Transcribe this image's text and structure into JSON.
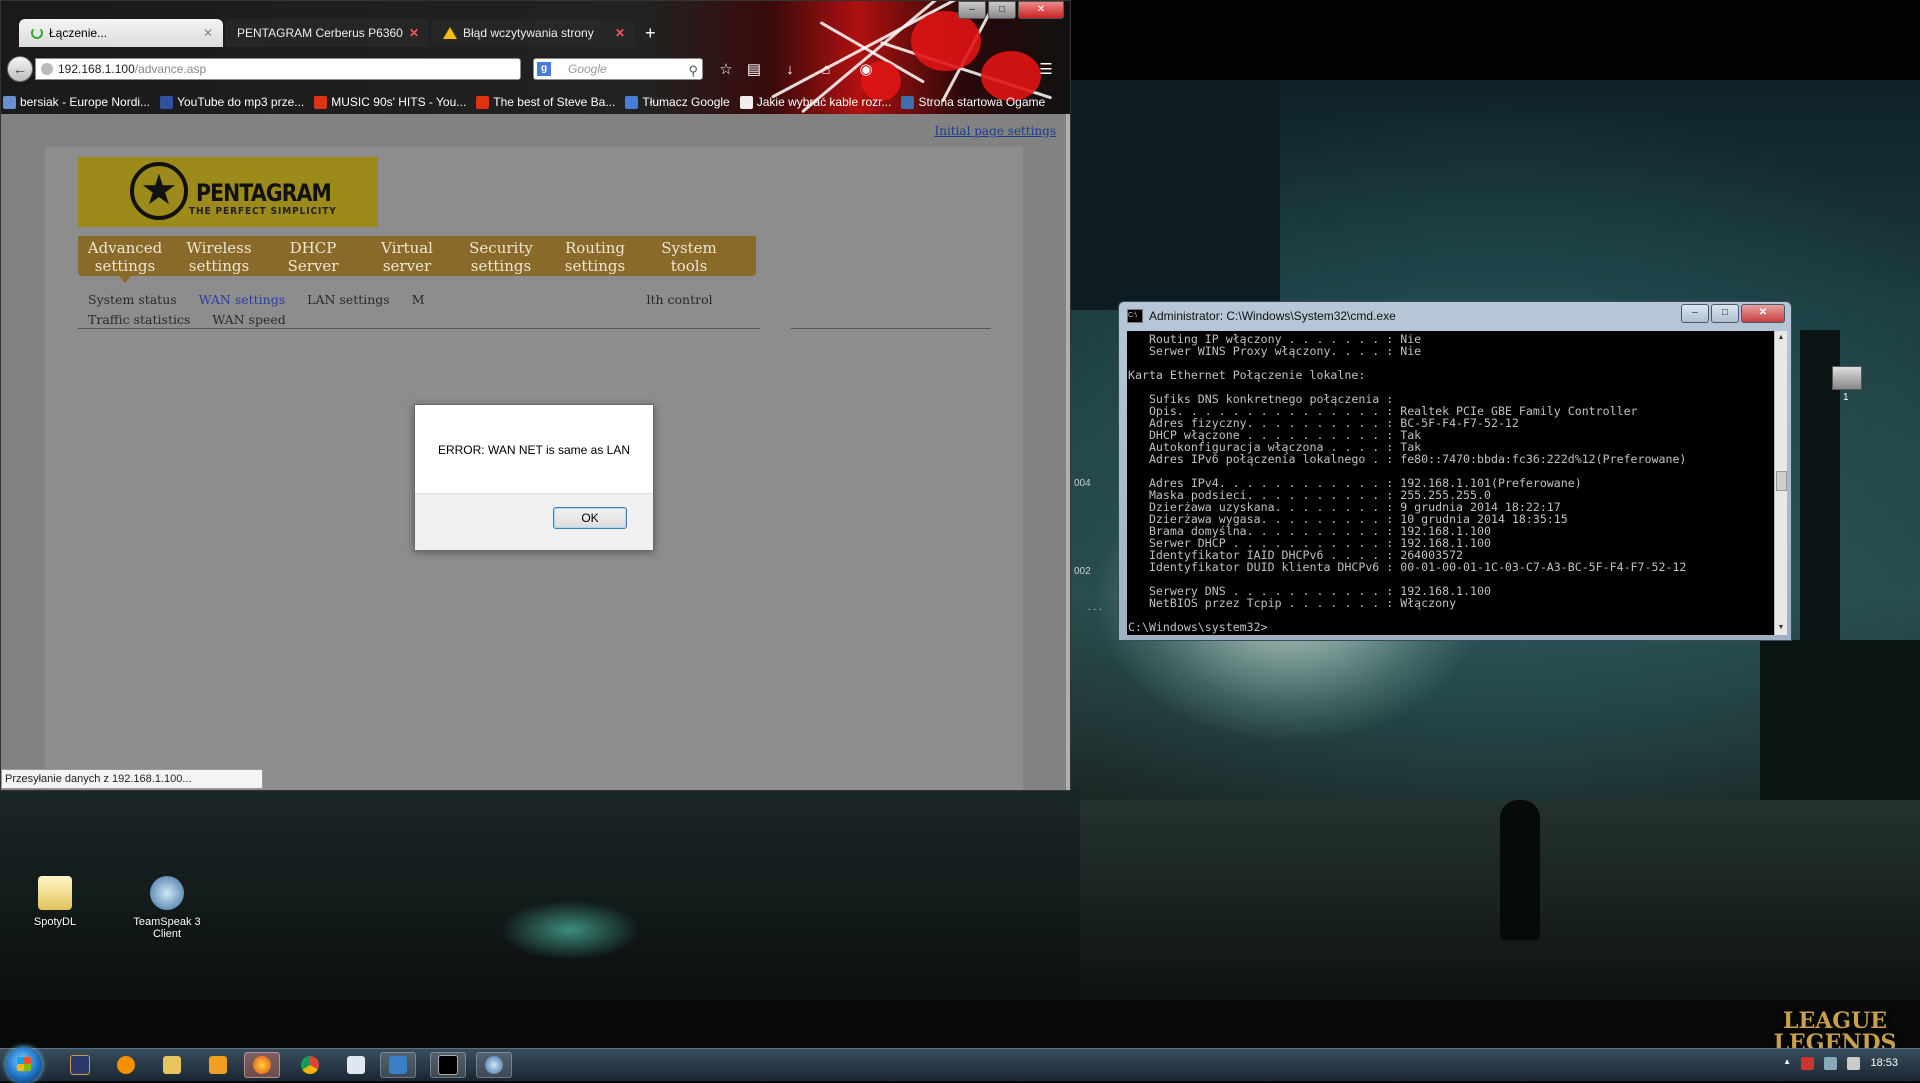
{
  "browser": {
    "tabs": [
      {
        "title": "Łączenie...",
        "active": true
      },
      {
        "title": "PENTAGRAM Cerberus P6360 P...",
        "active": false
      },
      {
        "title": "Błąd wczytywania strony",
        "active": false
      }
    ],
    "new_tab_label": "+",
    "url_host": "192.168.1.100",
    "url_path": "/advance.asp",
    "search_placeholder": "Google",
    "bookmarks": [
      "bersiak - Europe Nordi...",
      "YouTube do mp3 prze...",
      "MUSIC 90s' HITS - You...",
      "The best of Steve Ba...",
      "Tłumacz Google",
      "Jakie wybrać kable rozr...",
      "Strona startowa Ogame"
    ],
    "status_text": "Przesyłanie danych z 192.168.1.100..."
  },
  "router_page": {
    "initial_link": "Initial page settings",
    "logo_brand": "PENTAGRAM",
    "logo_tagline": "THE PERFECT SIMPLICITY",
    "menu": [
      {
        "line1": "Advanced",
        "line2": "settings"
      },
      {
        "line1": "Wireless",
        "line2": "settings"
      },
      {
        "line1": "DHCP",
        "line2": "Server"
      },
      {
        "line1": "Virtual",
        "line2": "server"
      },
      {
        "line1": "Security",
        "line2": "settings"
      },
      {
        "line1": "Routing",
        "line2": "settings"
      },
      {
        "line1": "System",
        "line2": "tools"
      }
    ],
    "submenu_row1": [
      "System status",
      "WAN settings",
      "LAN settings",
      "M",
      "lth control"
    ],
    "submenu_row2": [
      "Traffic statistics",
      "WAN speed"
    ]
  },
  "dialog": {
    "message": "ERROR: WAN NET is same as LAN",
    "ok_label": "OK"
  },
  "cmd": {
    "title": "Administrator: C:\\Windows\\System32\\cmd.exe",
    "output": "   Routing IP włączony . . . . . . . : Nie\n   Serwer WINS Proxy włączony. . . . : Nie\n\nKarta Ethernet Połączenie lokalne:\n\n   Sufiks DNS konkretnego połączenia :\n   Opis. . . . . . . . . . . . . . . : Realtek PCIe GBE Family Controller\n   Adres fizyczny. . . . . . . . . . : BC-5F-F4-F7-52-12\n   DHCP włączone . . . . . . . . . . : Tak\n   Autokonfiguracja włączona . . . . : Tak\n   Adres IPv6 połączenia lokalnego . : fe80::7470:bbda:fc36:222d%12(Preferowane)\n\n   Adres IPv4. . . . . . . . . . . . : 192.168.1.101(Preferowane)\n   Maska podsieci. . . . . . . . . . : 255.255.255.0\n   Dzierżawa uzyskana. . . . . . . . : 9 grudnia 2014 18:22:17\n   Dzierżawa wygasa. . . . . . . . . : 10 grudnia 2014 18:35:15\n   Brama domyślna. . . . . . . . . . : 192.168.1.100\n   Serwer DHCP . . . . . . . . . . . : 192.168.1.100\n   Identyfikator IAID DHCPv6 . . . . : 264003572\n   Identyfikator DUID klienta DHCPv6 : 00-01-00-01-1C-03-C7-A3-BC-5F-F4-F7-52-12\n\n   Serwery DNS . . . . . . . . . . . : 192.168.1.100\n   NetBIOS przez Tcpip . . . . . . . : Włączony\n\nC:\\Windows\\system32>"
  },
  "desktop": {
    "icons": [
      "SpotyDL",
      "TeamSpeak 3 Client"
    ],
    "brand_logo_line1": "LEAGUE",
    "brand_logo_line2": "LEGENDS",
    "stray_text": [
      "004",
      "002",
      ". . .",
      "1"
    ]
  },
  "taskbar": {
    "clock": "18:53",
    "tray_arrow": "▲"
  },
  "colors": {
    "router_menu_bg": "#8a6a2a",
    "router_logo_bg": "#9c8a1a",
    "active_submenu": "#2a3fa0",
    "cmd_bg": "#000000",
    "cmd_fg": "#c0c0c0"
  }
}
